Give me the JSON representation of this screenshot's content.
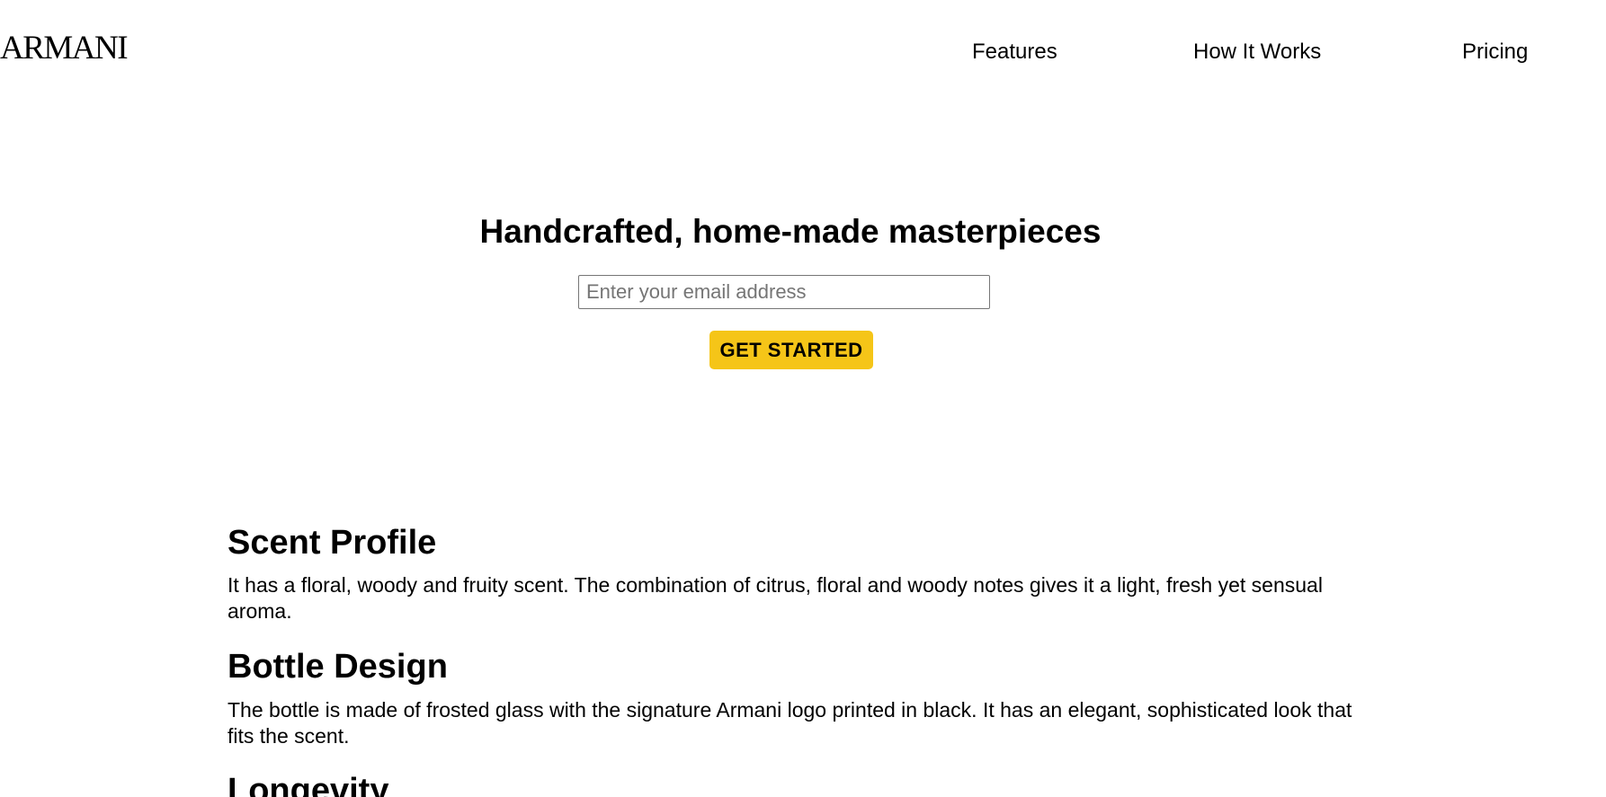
{
  "header": {
    "logo": "ARMANI",
    "nav": {
      "features": "Features",
      "how_it_works": "How It Works",
      "pricing": "Pricing"
    }
  },
  "hero": {
    "title": "Handcrafted, home-made masterpieces",
    "email_placeholder": "Enter your email address",
    "cta_label": "GET STARTED"
  },
  "features": {
    "scent_profile": {
      "heading": "Scent Profile",
      "text": "It has a floral, woody and fruity scent. The combination of citrus, floral and woody notes gives it a light, fresh yet sensual aroma."
    },
    "bottle_design": {
      "heading": "Bottle Design",
      "text": "The bottle is made of frosted glass with the signature Armani logo printed in black. It has an elegant, sophisticated look that fits the scent."
    },
    "longevity": {
      "heading": "Longevity"
    }
  },
  "colors": {
    "cta_background": "#f5c518",
    "text": "#000000",
    "background": "#ffffff"
  }
}
